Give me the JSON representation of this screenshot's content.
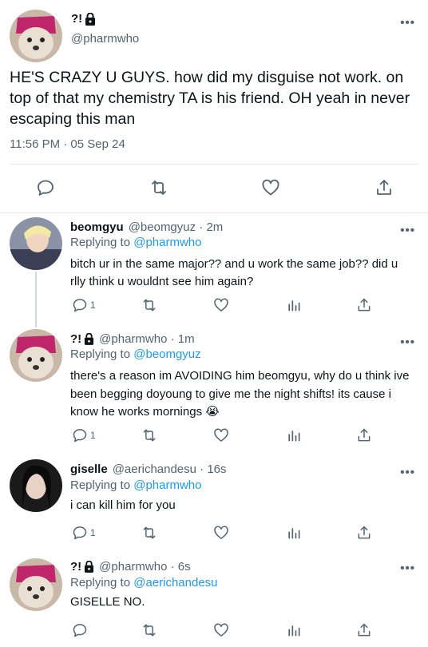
{
  "main_tweet": {
    "display_name": "?!",
    "handle": "@pharmwho",
    "text": "HE'S CRAZY U GUYS. how did my disguise not work. on top of that my chemistry TA is his friend. OH yeah in never escaping this man",
    "timestamp": "11:56 PM · 05 Sep 24",
    "more_label": "•••"
  },
  "replies": [
    {
      "display_name": "beomgyu",
      "handle": "@beomgyuz · 2m",
      "replying_prefix": "Replying to ",
      "replying_to": "@pharmwho",
      "text": "bitch ur in the same major?? and u work the same job?? did u rlly think u wouldnt see him again?",
      "reply_count": "1",
      "has_lock": false
    },
    {
      "display_name": "?!",
      "handle": "@pharmwho · 1m",
      "replying_prefix": "Replying to ",
      "replying_to": "@beomgyuz",
      "text": "there's a reason im AVOIDING him beomgyu, why do u think ive been begging doyoung to give me the night shifts! its cause i know he works mornings 😭",
      "reply_count": "1",
      "has_lock": true
    },
    {
      "display_name": "giselle",
      "handle": "@aerichandesu · 16s",
      "replying_prefix": "Replying to ",
      "replying_to": "@pharmwho",
      "text": "i can kill him for you",
      "reply_count": "1",
      "has_lock": false
    },
    {
      "display_name": "?!",
      "handle": "@pharmwho · 6s",
      "replying_prefix": "Replying to ",
      "replying_to": "@aerichandesu",
      "text": "GISELLE NO.",
      "reply_count": "",
      "has_lock": true
    }
  ],
  "more_label": "•••",
  "colors": {
    "accent": "#1d9bf0",
    "secondary_text": "#536471",
    "divider": "#e6e6e6"
  },
  "icons": [
    "reply-icon",
    "retweet-icon",
    "like-icon",
    "analytics-icon",
    "share-icon",
    "lock-icon",
    "more-icon"
  ]
}
